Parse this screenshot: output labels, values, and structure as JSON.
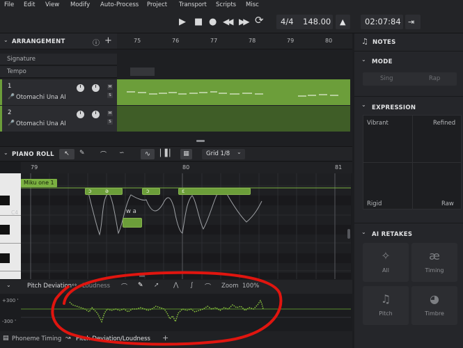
{
  "menu": [
    "File",
    "Edit",
    "View",
    "Modify",
    "Auto-Process",
    "Project",
    "Transport",
    "Scripts",
    "Misc"
  ],
  "transport": {
    "time_signature": "4/4",
    "tempo": "148.00",
    "position": "02:07:84"
  },
  "arrangement": {
    "title": "ARRANGEMENT",
    "ruler": [
      "75",
      "76",
      "77",
      "78",
      "79",
      "80"
    ],
    "signature_label": "Signature",
    "tempo_label": "Tempo",
    "tracks": [
      {
        "number": "1",
        "voice": "Otomachi Una AI",
        "mute": "M",
        "solo": "S"
      },
      {
        "number": "2",
        "voice": "Otomachi Una AI",
        "mute": "M",
        "solo": "S"
      }
    ]
  },
  "piano_roll": {
    "title": "PIANO ROLL",
    "grid": "Grid 1/8",
    "ruler": [
      "79",
      "80",
      "81"
    ],
    "region_label": "Miku one 1",
    "key_label": "C4",
    "lyric": "w a",
    "notes": [
      "ɔ",
      "ə",
      "ɛ",
      "ɔ"
    ]
  },
  "param_panel": {
    "pitch_deviation": "Pitch Deviation",
    "loudness": "Loudness",
    "zoom_label": "Zoom",
    "zoom_value": "100%",
    "y_top": "+300 '",
    "y_bottom": "-300 '",
    "tab_phoneme": "Phoneme Timing",
    "tab_pitch": "Pitch Deviation/Loudness",
    "add": "+"
  },
  "notes_panel": {
    "title": "NOTES",
    "mode_title": "MODE",
    "mode_sing": "Sing",
    "mode_rap": "Rap",
    "expression_title": "EXPRESSION",
    "vibrant": "Vibrant",
    "refined": "Refined",
    "rigid": "Rigid",
    "raw": "Raw",
    "retakes_title": "AI RETAKES",
    "retakes": [
      {
        "label": "All",
        "icon": "sparkle-icon"
      },
      {
        "label": "Timing",
        "icon": "ae-icon"
      },
      {
        "label": "Pitch",
        "icon": "music-note-icon"
      },
      {
        "label": "Timbre",
        "icon": "lips-icon"
      }
    ]
  },
  "colors": {
    "accent_green": "#6c9e3a",
    "annotation_red": "#e0150f",
    "background": "#1c1d20"
  }
}
